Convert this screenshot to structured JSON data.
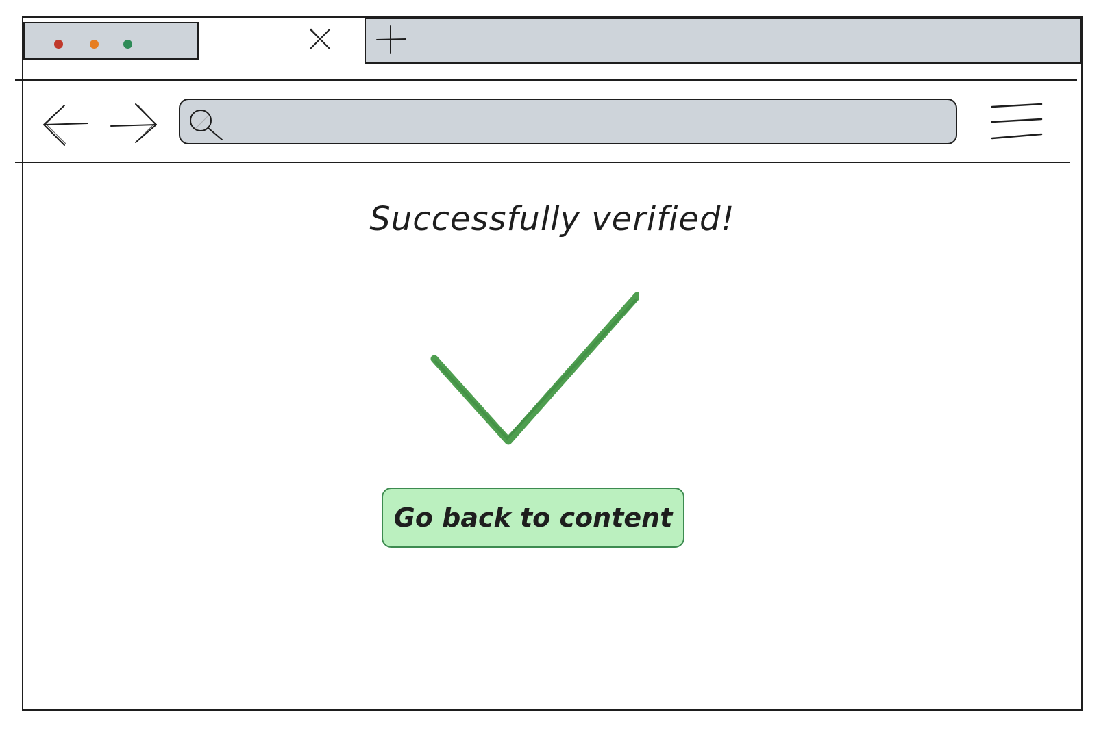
{
  "browser": {
    "window_controls": [
      {
        "name": "close",
        "color": "#c0392b"
      },
      {
        "name": "minimize",
        "color": "#e67e22"
      },
      {
        "name": "maximize",
        "color": "#2e8b57"
      }
    ],
    "tab_close_icon": "close-icon",
    "new_tab_icon": "plus-icon",
    "back_icon": "arrow-left-icon",
    "forward_icon": "arrow-right-icon",
    "search_icon": "search-icon",
    "menu_icon": "hamburger-menu-icon",
    "address": {
      "value": "",
      "placeholder": ""
    },
    "chrome_color": "#ced4da"
  },
  "page": {
    "title": "Successfully verified!",
    "status_icon": "checkmark-icon",
    "status_color": "#4e9e4f",
    "primary_button_label": "Go back to content",
    "button_bg": "#bbf0bf",
    "button_border": "#3d8b50"
  }
}
